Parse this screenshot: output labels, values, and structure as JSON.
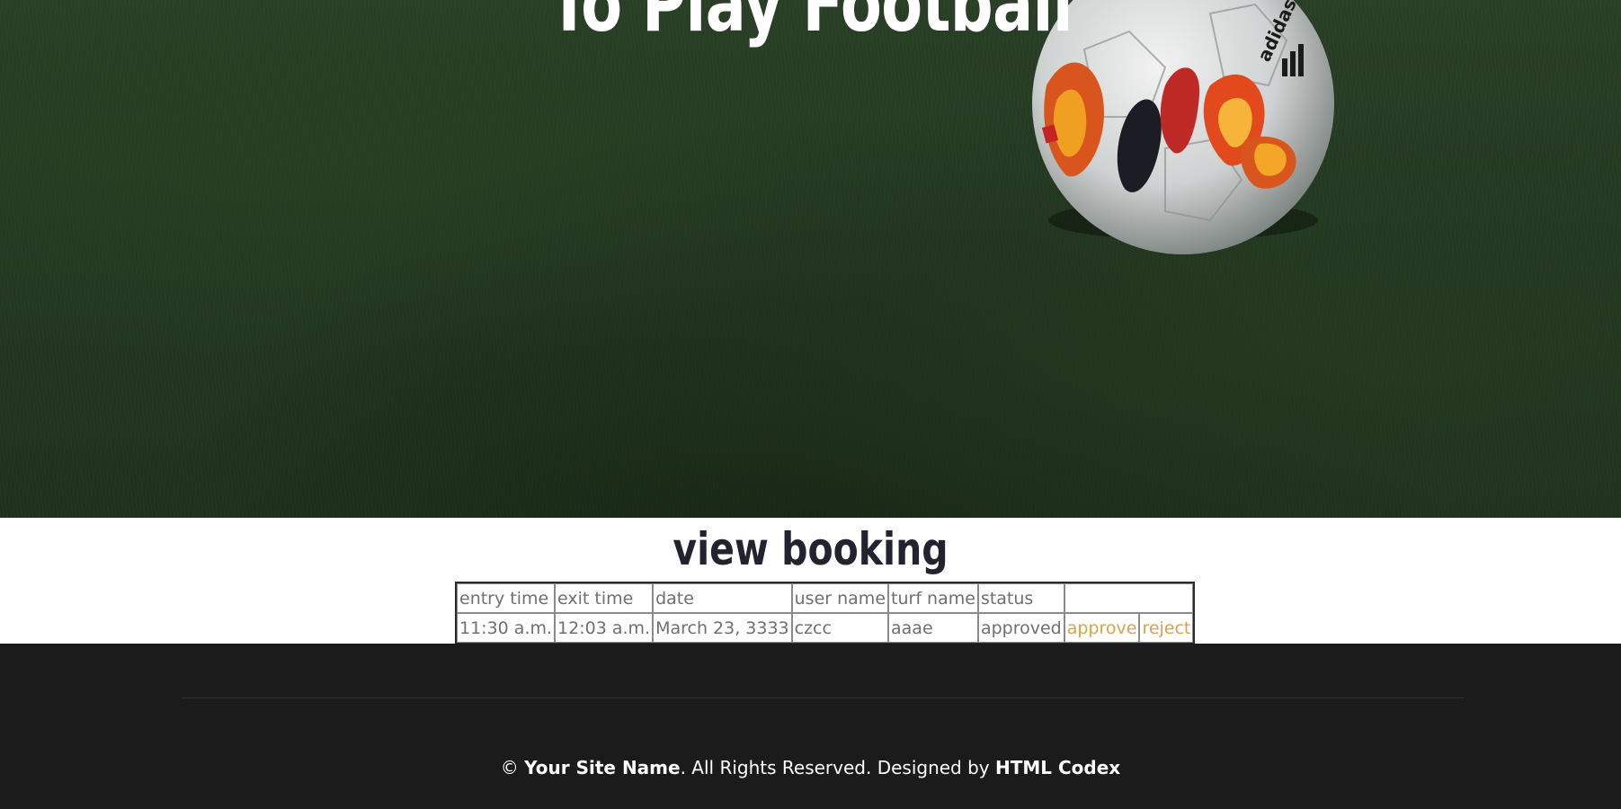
{
  "hero": {
    "title": "To Play Football",
    "ball_icon": "soccer-ball-icon",
    "ball_brand": "adidas"
  },
  "booking": {
    "title": "view booking",
    "columns": [
      "entry time",
      "exit time",
      "date",
      "user name",
      "turf name",
      "status",
      ""
    ],
    "rows": [
      {
        "entry_time": "11:30 a.m.",
        "exit_time": "12:03 a.m.",
        "date": "March 23, 3333",
        "user_name": "czcc",
        "turf_name": "aaae",
        "status": "approved",
        "approve_label": "approve",
        "reject_label": "reject"
      }
    ]
  },
  "footer": {
    "copyright_symbol": "©",
    "site_name": "Your Site Name",
    "rights_text": ". All Rights Reserved. Designed by ",
    "designer": "HTML Codex"
  },
  "colors": {
    "link_accent": "#d9a245",
    "footer_bg": "#1b1b1b",
    "title_dark": "#232330"
  }
}
